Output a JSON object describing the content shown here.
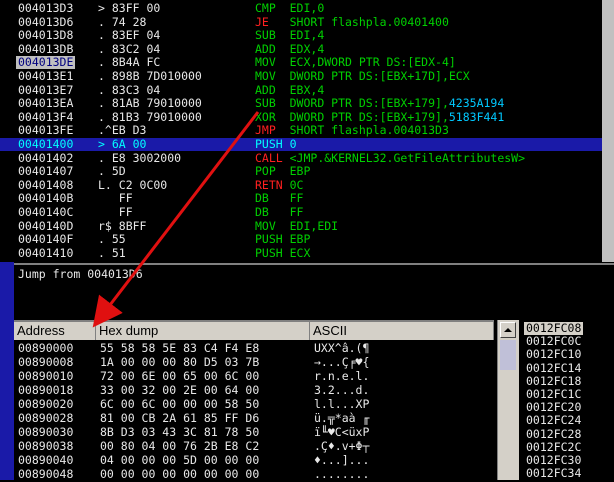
{
  "disassembly": [
    {
      "addr": "004013D3",
      "bytes": "> 83FF 00",
      "op": "CMP",
      "op_class": "op",
      "args": "EDI,0",
      "target": ""
    },
    {
      "addr": "004013D6",
      "bytes": ". 74 28",
      "op": "JE",
      "op_class": "opjmp",
      "args": "SHORT flashpla.00401400",
      "target": ""
    },
    {
      "addr": "004013D8",
      "bytes": ". 83EF 04",
      "op": "SUB",
      "op_class": "op",
      "args": "EDI,4",
      "target": ""
    },
    {
      "addr": "004013DB",
      "bytes": ". 83C2 04",
      "op": "ADD",
      "op_class": "op",
      "args": "EDX,4",
      "target": ""
    },
    {
      "addr": "004013DE",
      "bytes": ". 8B4A FC",
      "op": "MOV",
      "op_class": "op",
      "args": "ECX,DWORD PTR DS:[EDX-4]",
      "target": ""
    },
    {
      "addr": "004013E1",
      "bytes": ". 898B 7D010000",
      "op": "MOV",
      "op_class": "op",
      "args": "DWORD PTR DS:[EBX+17D],ECX",
      "target": ""
    },
    {
      "addr": "004013E7",
      "bytes": ". 83C3 04",
      "op": "ADD",
      "op_class": "op",
      "args": "EBX,4",
      "target": ""
    },
    {
      "addr": "004013EA",
      "bytes": ". 81AB 79010000",
      "op": "SUB",
      "op_class": "op",
      "args": "DWORD PTR DS:[EBX+179],",
      "target": "4235A194"
    },
    {
      "addr": "004013F4",
      "bytes": ". 81B3 79010000",
      "op": "XOR",
      "op_class": "op",
      "args": "DWORD PTR DS:[EBX+179],",
      "target": "5183F441"
    },
    {
      "addr": "004013FE",
      "bytes": ".^EB D3",
      "op": "JMP",
      "op_class": "opjmp",
      "args": "SHORT flashpla.004013D3",
      "target": ""
    },
    {
      "addr": "00401400",
      "bytes": "> 6A 00",
      "op": "PUSH",
      "op_class": "op",
      "args": "0",
      "target": ""
    },
    {
      "addr": "00401402",
      "bytes": ". E8 3002000",
      "op": "CALL",
      "op_class": "opcall",
      "args": "<JMP.&KERNEL32.GetFileAttributesW>",
      "target": ""
    },
    {
      "addr": "00401407",
      "bytes": ". 5D",
      "op": "POP",
      "op_class": "op",
      "args": "EBP",
      "target": ""
    },
    {
      "addr": "00401408",
      "bytes": "L. C2 0C00",
      "op": "RETN",
      "op_class": "opret",
      "args": "0C",
      "target": ""
    },
    {
      "addr": "0040140B",
      "bytes": "   FF",
      "op": "DB",
      "op_class": "op",
      "args": "FF",
      "target": ""
    },
    {
      "addr": "0040140C",
      "bytes": "   FF",
      "op": "DB",
      "op_class": "op",
      "args": "FF",
      "target": ""
    },
    {
      "addr": "0040140D",
      "bytes": "r$ 8BFF",
      "op": "MOV",
      "op_class": "op",
      "args": "EDI,EDI",
      "target": ""
    },
    {
      "addr": "0040140F",
      "bytes": ". 55",
      "op": "PUSH",
      "op_class": "op",
      "args": "EBP",
      "target": ""
    },
    {
      "addr": "00401410",
      "bytes": ". 51",
      "op": "PUSH",
      "op_class": "op",
      "args": "ECX",
      "target": ""
    }
  ],
  "selected_addr_row": 4,
  "highlight_row": 10,
  "info_text": "Jump from 004013D6",
  "dump_headers": {
    "address": "Address",
    "hex": "Hex dump",
    "ascii": "ASCII"
  },
  "dump_rows": [
    {
      "addr": "00890000",
      "hex": "55 58 58 5E 83 C4 F4 E8",
      "ascii": "UXX^â.(¶"
    },
    {
      "addr": "00890008",
      "hex": "1A 00 00 00 80 D5 03 7B",
      "ascii": "→...Ç╒♥{"
    },
    {
      "addr": "00890010",
      "hex": "72 00 6E 00 65 00 6C 00",
      "ascii": "r.n.e.l."
    },
    {
      "addr": "00890018",
      "hex": "33 00 32 00 2E 00 64 00",
      "ascii": "3.2...d."
    },
    {
      "addr": "00890020",
      "hex": "6C 00 6C 00 00 00 58 50",
      "ascii": "l.l...XP"
    },
    {
      "addr": "00890028",
      "hex": "81 00 CB 2A 61 85 FF D6",
      "ascii": "ü.╦*aà ╓"
    },
    {
      "addr": "00890030",
      "hex": "8B D3 03 43 3C 81 78 50",
      "ascii": "ï╙♥C<üxP"
    },
    {
      "addr": "00890038",
      "hex": "00 80 04 00 76 2B E8 C2",
      "ascii": ".Ç♦.v+Φ┬"
    },
    {
      "addr": "00890040",
      "hex": "04 00 00 00 5D 00 00 00",
      "ascii": "♦...]..."
    },
    {
      "addr": "00890048",
      "hex": "00 00 00 00 00 00 00 00",
      "ascii": "........"
    }
  ],
  "stack_rows": [
    "0012FC08",
    "0012FC0C",
    "0012FC10",
    "0012FC14",
    "0012FC18",
    "0012FC1C",
    "0012FC20",
    "0012FC24",
    "0012FC28",
    "0012FC2C",
    "0012FC30",
    "0012FC34"
  ],
  "colors": {
    "accent_highlight": "#1a1aa8",
    "arrow": "#e01010",
    "mnemonic": "#00d000",
    "jump": "#ff2020",
    "operand_cyan": "#00c8ff"
  }
}
